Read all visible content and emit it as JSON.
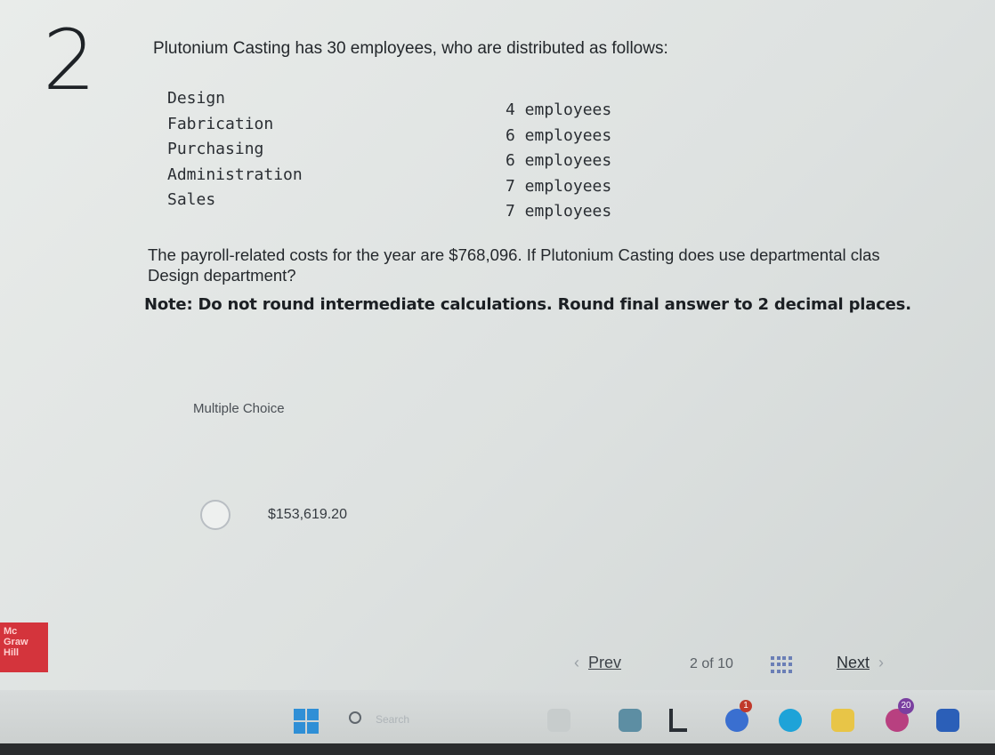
{
  "question": {
    "number": "2",
    "intro": "Plutonium Casting has 30 employees, who are distributed as follows:",
    "departments": [
      {
        "name": "Design",
        "count": "4 employees"
      },
      {
        "name": "Fabrication",
        "count": "6 employees"
      },
      {
        "name": "Purchasing",
        "count": "6 employees"
      },
      {
        "name": "Administration",
        "count": "7 employees"
      },
      {
        "name": "Sales",
        "count": "7 employees"
      }
    ],
    "text_line1": "The payroll-related costs for the year are $768,096. If Plutonium Casting does use departmental clas",
    "text_line2": "Design department?",
    "note": "Note: Do not round intermediate calculations. Round final answer to 2 decimal places."
  },
  "answer": {
    "type_label": "Multiple Choice",
    "choices": [
      "$153,619.20"
    ]
  },
  "logo": {
    "line1": "Mc",
    "line2": "Graw",
    "line3": "Hill"
  },
  "navigation": {
    "prev_label": "Prev",
    "page_current": "2",
    "page_of": "of",
    "page_total": "10",
    "next_label": "Next"
  },
  "taskbar": {
    "search_placeholder": "Search",
    "badges": {
      "app1": "1",
      "app2": "20"
    }
  },
  "colors": {
    "brand_red": "#d4343c",
    "windows_blue": "#2f8fd6"
  }
}
